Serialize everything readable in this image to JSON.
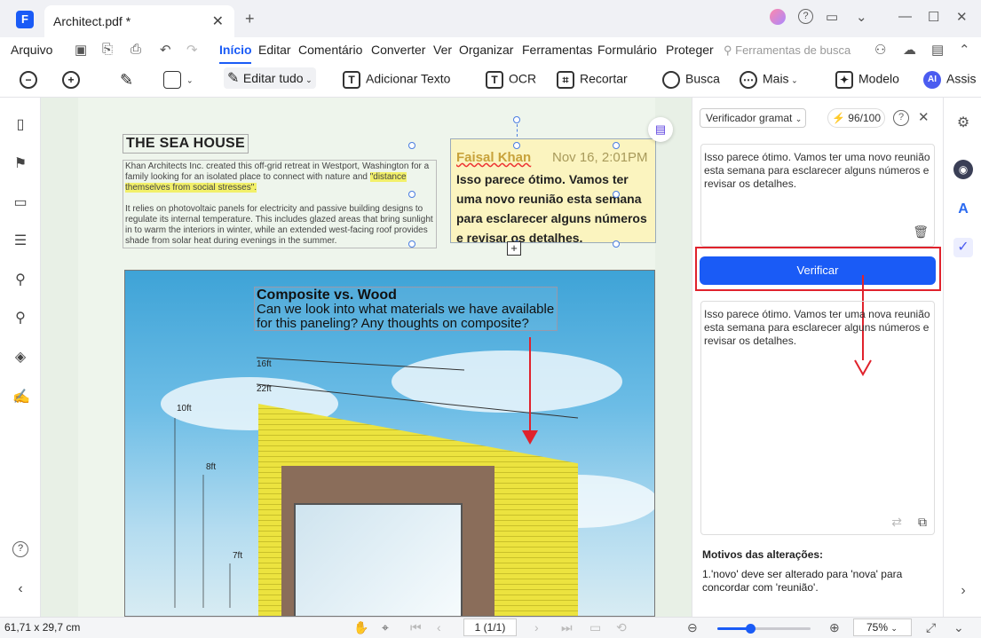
{
  "titlebar": {
    "tab_title": "Architect.pdf *",
    "logo": "F"
  },
  "menu": {
    "arquivo": "Arquivo",
    "items": [
      "Início",
      "Editar",
      "Comentário",
      "Converter",
      "Ver",
      "Organizar",
      "Ferramentas",
      "Formulário",
      "Proteger"
    ],
    "search_placeholder": "Ferramentas de busca"
  },
  "toolbar": {
    "edit_all": "Editar tudo",
    "add_text": "Adicionar Texto",
    "ocr": "OCR",
    "crop": "Recortar",
    "search": "Busca",
    "more": "Mais",
    "template": "Modelo",
    "ai_badge": "AI",
    "assistant": "Assis"
  },
  "document": {
    "heading": "THE SEA HOUSE",
    "para1_a": "Khan Architects Inc. created this off-grid retreat in Westport, Washington for a family looking for an isolated place to connect with nature and ",
    "para1_hl": "\"distance themselves from social stresses\".",
    "para2": "It relies on photovoltaic panels for electricity and passive building designs to regulate its internal temperature. This includes glazed areas that bring sunlight in to warm the interiors in winter, while an extended west-facing roof provides shade from solar heat during evenings in the summer.",
    "comment": {
      "author": "Faisal Khan",
      "date": "Nov 16, 2:01PM",
      "text": "Isso parece ótimo. Vamos ter uma novo reunião esta semana para esclarecer alguns números e revisar os detalhes."
    },
    "image_annotation": {
      "title": "Composite vs. Wood",
      "text": "Can we look into what materials we have available for this paneling? Any thoughts on composite?"
    },
    "dimensions": [
      "16ft",
      "22ft",
      "10ft",
      "8ft",
      "7ft"
    ]
  },
  "panel": {
    "tool_select": "Verificador gramat",
    "credits": "96/100",
    "input_text": "Isso parece ótimo. Vamos ter uma novo reunião esta semana para esclarecer alguns números e revisar os detalhes.",
    "verify_label": "Verificar",
    "output_text": "Isso parece ótimo. Vamos ter uma nova reunião esta semana para esclarecer alguns números e revisar os detalhes.",
    "reasons_title": "Motivos das alterações:",
    "reasons_text": "1.'novo' deve ser alterado para 'nova' para concordar com 'reunião'."
  },
  "status": {
    "page_size": "61,71 x 29,7 cm",
    "page_indicator": "1 (1/1)",
    "zoom": "75%",
    "zoom_level": 0.35
  },
  "colors": {
    "accent": "#1a5bf6",
    "highlight_frame": "#e0222c",
    "comment_bg": "#fbf4bf"
  }
}
